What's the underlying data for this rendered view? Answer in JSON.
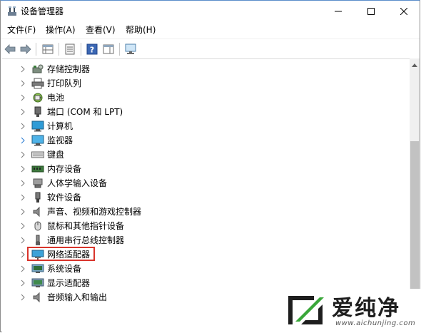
{
  "window": {
    "title": "设备管理器"
  },
  "menu": [
    "文件(F)",
    "操作(A)",
    "查看(V)",
    "帮助(H)"
  ],
  "toolbar": {
    "buttons": [
      {
        "name": "back",
        "icon": "back-arrow-icon"
      },
      {
        "name": "forward",
        "icon": "forward-arrow-icon"
      },
      {
        "name": "properties-view",
        "icon": "grid-view-icon"
      },
      {
        "name": "properties",
        "icon": "properties-icon"
      },
      {
        "name": "help",
        "icon": "help-icon"
      },
      {
        "name": "pane",
        "icon": "pane-icon"
      },
      {
        "name": "scan-hardware",
        "icon": "monitor-scan-icon"
      }
    ]
  },
  "tree": {
    "items": [
      {
        "label": "存储控制器",
        "icon": "storage-controller-icon"
      },
      {
        "label": "打印队列",
        "icon": "printer-icon"
      },
      {
        "label": "电池",
        "icon": "battery-icon"
      },
      {
        "label": "端口 (COM 和 LPT)",
        "icon": "port-icon"
      },
      {
        "label": "计算机",
        "icon": "computer-icon"
      },
      {
        "label": "监视器",
        "icon": "monitor-icon"
      },
      {
        "label": "键盘",
        "icon": "keyboard-icon"
      },
      {
        "label": "内存设备",
        "icon": "memory-icon"
      },
      {
        "label": "人体学输入设备",
        "icon": "hid-icon"
      },
      {
        "label": "软件设备",
        "icon": "software-device-icon"
      },
      {
        "label": "声音、视频和游戏控制器",
        "icon": "speaker-icon"
      },
      {
        "label": "鼠标和其他指针设备",
        "icon": "mouse-icon"
      },
      {
        "label": "通用串行总线控制器",
        "icon": "usb-icon"
      },
      {
        "label": "网络适配器",
        "icon": "network-adapter-icon",
        "highlighted": true
      },
      {
        "label": "系统设备",
        "icon": "system-device-icon"
      },
      {
        "label": "显示适配器",
        "icon": "display-adapter-icon"
      },
      {
        "label": "音频输入和输出",
        "icon": "audio-io-icon"
      }
    ]
  },
  "watermark": {
    "name": "爱纯净",
    "url": "www.aichunjing.com"
  },
  "colors": {
    "highlight_border": "#d9342b",
    "accent_blue": "#2b7cd3",
    "chevron": "#7a7a7a"
  }
}
